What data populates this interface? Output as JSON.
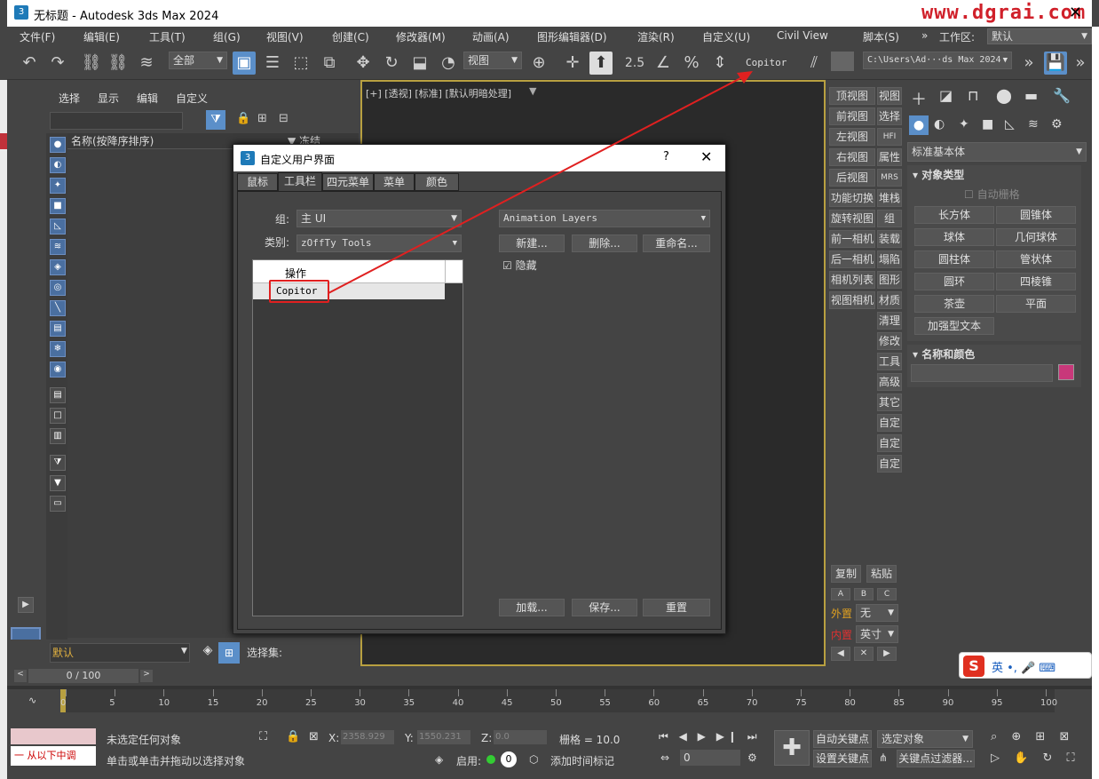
{
  "window": {
    "title": "无标题 - Autodesk 3ds Max 2024",
    "watermark": "www.dgrai.com",
    "app_icon": "3"
  },
  "menu": [
    "文件(F)",
    "编辑(E)",
    "工具(T)",
    "组(G)",
    "视图(V)",
    "创建(C)",
    "修改器(M)",
    "动画(A)",
    "图形编辑器(D)",
    "渲染(R)",
    "自定义(U)",
    "Civil View",
    "脚本(S)"
  ],
  "workspace": {
    "label": "工作区:",
    "value": "默认"
  },
  "toolbar": {
    "selection_filter": "全部",
    "ref_coord": "视图",
    "copitor_label": "Copitor",
    "path": "C:\\Users\\Ad···ds Max 2024",
    "snap_num": "2.5"
  },
  "scene_explorer": {
    "tabs": [
      "选择",
      "显示",
      "编辑",
      "自定义"
    ],
    "col_name": "名称(按降序排序)",
    "col_freeze": "▼ 冻结",
    "layer": "默认",
    "selection_set": "选择集:"
  },
  "viewport": {
    "label": "[+] [透视] [标准] [默认明暗处理]"
  },
  "viewport_menu": {
    "left": [
      "顶视图",
      "前视图",
      "左视图",
      "右视图",
      "后视图",
      "功能切换",
      "旋转视图",
      "前一相机",
      "后一相机",
      "相机列表",
      "视图相机"
    ],
    "right": [
      "视图",
      "选择",
      "HFI",
      "属性",
      "MRS",
      "堆栈",
      "组",
      "装载",
      "塌陷",
      "图形",
      "材质",
      "清理",
      "修改",
      "工具",
      "高级",
      "其它",
      "自定",
      "自定",
      "自定"
    ],
    "copy": "复制",
    "paste": "粘贴",
    "abc": [
      "A",
      "B",
      "C"
    ],
    "outer_label": "外置",
    "outer_val": "无",
    "inner_label": "内置",
    "inner_val": "英寸"
  },
  "command_panel": {
    "category": "标准基本体",
    "rollout1": "对象类型",
    "auto_grid": "自动栅格",
    "objects": [
      "长方体",
      "圆锥体",
      "球体",
      "几何球体",
      "圆柱体",
      "管状体",
      "圆环",
      "四棱锥",
      "茶壶",
      "平面",
      "加强型文本"
    ],
    "rollout2": "名称和颜色",
    "color": "#c8387a"
  },
  "dialog": {
    "title": "自定义用户界面",
    "help": "?",
    "tabs": [
      "鼠标",
      "工具栏",
      "四元菜单",
      "菜单",
      "颜色"
    ],
    "group_label": "组:",
    "group_val": "主 UI",
    "category_label": "类别:",
    "category_val": "zOffTy Tools",
    "list_header": "操作",
    "list_item": "Copitor",
    "toolbar_select": "Animation Layers",
    "new": "新建...",
    "delete": "删除...",
    "rename": "重命名...",
    "hide": "隐藏",
    "load": "加载...",
    "save": "保存...",
    "reset": "重置"
  },
  "timeline": {
    "frame": "0 / 100",
    "ticks": [
      "0",
      "5",
      "10",
      "15",
      "20",
      "25",
      "30",
      "35",
      "40",
      "45",
      "50",
      "55",
      "60",
      "65",
      "70",
      "75",
      "80",
      "85",
      "90",
      "95",
      "100"
    ]
  },
  "status": {
    "maxscript": "一  从以下中调",
    "msg1": "未选定任何对象",
    "msg2": "单击或单击并拖动以选择对象",
    "x_label": "X:",
    "x": "2358.929",
    "y_label": "Y:",
    "y": "1550.231",
    "z_label": "Z:",
    "z": "0.0",
    "grid": "栅格 = 10.0",
    "enable": "启用:",
    "addtime": "添加时间标记",
    "autokey": "自动关键点",
    "setkey": "设置关键点",
    "selobj": "选定对象",
    "keyfilter": "关键点过滤器...",
    "frame": "0"
  },
  "ime": {
    "text": "英 •, 🎤 ⌨"
  }
}
